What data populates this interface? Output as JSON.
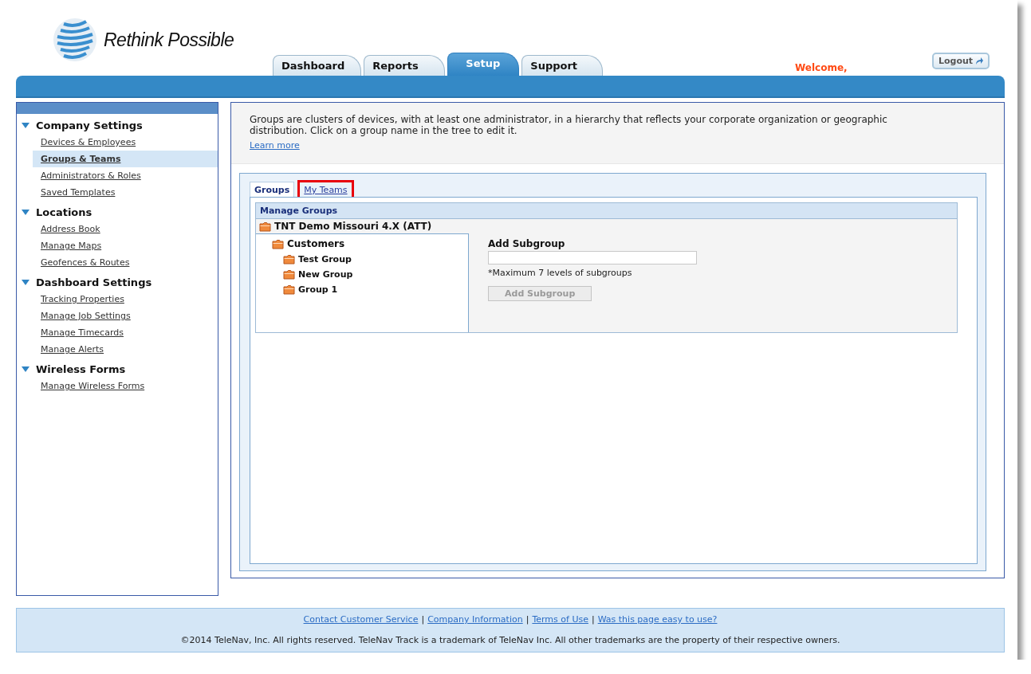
{
  "header": {
    "logo_text": "Rethink Possible",
    "welcome": "Welcome,",
    "logout": "Logout"
  },
  "tabs": [
    {
      "label": "Dashboard",
      "selected": false
    },
    {
      "label": "Reports",
      "selected": false
    },
    {
      "label": "Setup",
      "selected": true
    },
    {
      "label": "Support",
      "selected": false
    }
  ],
  "sidebar": {
    "sections": [
      {
        "title": "Company Settings",
        "expanded": true,
        "items": [
          {
            "label": "Devices & Employees",
            "selected": false
          },
          {
            "label": "Groups & Teams",
            "selected": true
          },
          {
            "label": "Administrators & Roles",
            "selected": false
          },
          {
            "label": "Saved Templates",
            "selected": false
          }
        ]
      },
      {
        "title": "Locations",
        "expanded": true,
        "items": [
          {
            "label": "Address Book",
            "selected": false
          },
          {
            "label": "Manage Maps",
            "selected": false
          },
          {
            "label": "Geofences & Routes",
            "selected": false
          }
        ]
      },
      {
        "title": "Dashboard Settings",
        "expanded": true,
        "items": [
          {
            "label": "Tracking Properties",
            "selected": false
          },
          {
            "label": "Manage Job Settings",
            "selected": false
          },
          {
            "label": "Manage Timecards",
            "selected": false
          },
          {
            "label": "Manage Alerts",
            "selected": false
          }
        ]
      },
      {
        "title": "Wireless Forms",
        "expanded": true,
        "items": [
          {
            "label": "Manage Wireless Forms",
            "selected": false
          }
        ]
      }
    ]
  },
  "intro": {
    "text": "Groups are clusters of devices, with at least one administrator, in a hierarchy that reflects your corporate organization or geographic distribution. Click on a group name in the tree to edit it.",
    "link": "Learn more"
  },
  "sub_tabs": [
    {
      "label": "Groups",
      "selected": true,
      "highlighted": false
    },
    {
      "label": "My Teams",
      "selected": false,
      "highlighted": true
    }
  ],
  "manage_groups": {
    "title": "Manage Groups",
    "tree": {
      "label": "TNT Demo Missouri 4.X (ATT)",
      "children": [
        {
          "label": "Customers",
          "children": [
            {
              "label": "Test Group"
            },
            {
              "label": "New Group"
            },
            {
              "label": "Group 1"
            }
          ]
        }
      ]
    },
    "add_subgroup": {
      "label": "Add Subgroup",
      "note": "*Maximum 7 levels of subgroups",
      "button": "Add Subgroup",
      "button_disabled": true
    }
  },
  "footer": {
    "links": [
      "Contact Customer Service",
      "Company Information",
      "Terms of Use",
      "Was this page easy to use?"
    ],
    "separators": [
      "|",
      "|",
      "|"
    ],
    "copyright": "©2014 TeleNav, Inc. All rights reserved. TeleNav Track is a trademark of TeleNav Inc. All other trademarks are the property of their respective owners."
  }
}
